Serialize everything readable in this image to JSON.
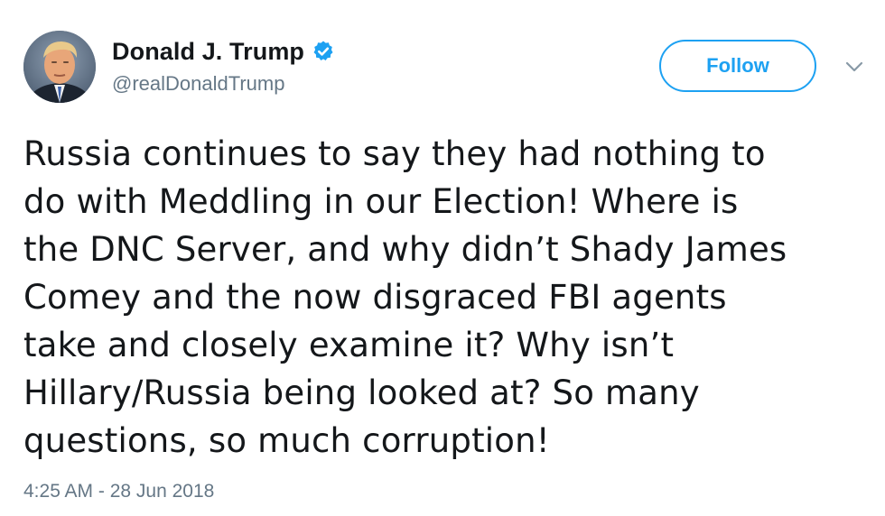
{
  "user": {
    "display_name": "Donald J. Trump",
    "handle": "@realDonaldTrump",
    "verified": true
  },
  "actions": {
    "follow_label": "Follow"
  },
  "tweet": {
    "lines": [
      "Russia continues to say they had nothing to",
      "do with Meddling in our Election! Where is",
      "the DNC Server, and why didn’t Shady James",
      "Comey and the now disgraced FBI agents",
      "take and closely examine it? Why isn’t",
      "Hillary/Russia being looked at? So many",
      "questions, so much corruption!"
    ],
    "timestamp": "4:25 AM - 28 Jun 2018"
  },
  "colors": {
    "accent": "#1da1f2",
    "text": "#14171a",
    "secondary_text": "#657786"
  },
  "icons": {
    "verified": "verified-badge-icon",
    "caret": "chevron-down-icon"
  }
}
